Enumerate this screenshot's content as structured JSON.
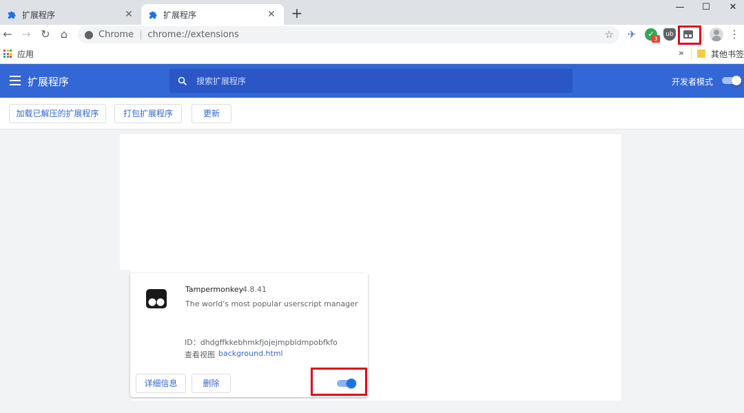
{
  "tabs": [
    {
      "title": "扩展程序",
      "active": false
    },
    {
      "title": "扩展程序",
      "active": true
    }
  ],
  "tabbar": {
    "new_tab": "+",
    "close": "✕"
  },
  "window_controls": {
    "minimize": "—",
    "maximize": "☐",
    "close": "✕"
  },
  "toolbar": {
    "back": "←",
    "forward": "→",
    "reload": "↻",
    "home": "⌂",
    "omnibox_label": "Chrome",
    "omnibox_separator": "|",
    "url": "chrome://extensions",
    "star": "☆",
    "ext_badge_count": "3",
    "menu": "⋮"
  },
  "bookmarks": {
    "apps_label": "应用",
    "overflow": "»",
    "other_bookmarks": "其他书签"
  },
  "header": {
    "title": "扩展程序",
    "search_placeholder": "搜索扩展程序",
    "dev_mode_label": "开发者模式",
    "dev_mode_enabled": true
  },
  "actions": {
    "load_unpacked": "加载已解压的扩展程序",
    "pack": "打包扩展程序",
    "update": "更新"
  },
  "extension": {
    "name": "Tampermonkey",
    "version": "4.8.41",
    "description": "The world's most popular userscript manager",
    "id_text": "ID：dhdgffkkebhmkfjojejmpbldmpobfkfo",
    "views_label": "查看视图",
    "views_link": "background.html",
    "details_button": "详细信息",
    "remove_button": "删除",
    "enabled": true
  },
  "colors": {
    "header_blue": "#3367d6",
    "highlight_red": "#e2001a",
    "link_blue": "#3367d6",
    "toggle_on": "#1a73e8"
  },
  "icons": {
    "tab_favicon": "puzzle-icon",
    "apps": "apps-grid-icon",
    "search": "search-icon",
    "menu": "hamburger-icon",
    "extension": "tampermonkey-icon"
  }
}
